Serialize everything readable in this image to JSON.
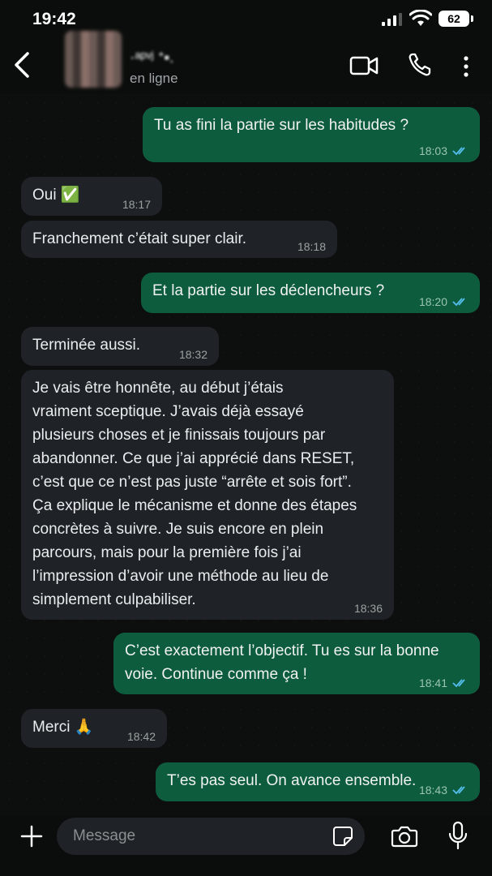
{
  "status_bar": {
    "time": "19:42",
    "battery": "62"
  },
  "header": {
    "contact_name": "·ᵃᵖᵛʲ ᐩ▪.",
    "status": "en ligne"
  },
  "icons": {
    "back": "chevron-left-icon",
    "video": "video-call-icon",
    "call": "phone-icon",
    "more": "more-vertical-icon",
    "plus": "plus-icon",
    "sticker": "sticker-icon",
    "camera": "camera-icon",
    "mic": "microphone-icon",
    "read": "double-check-icon"
  },
  "colors": {
    "incoming": "#1f2226",
    "outgoing": "#0d5c3e",
    "read_ticks": "#53bdeb"
  },
  "messages": [
    {
      "dir": "out",
      "text": "Tu as fini la partie sur les habitudes ?",
      "time": "18:03",
      "read": true
    },
    {
      "dir": "in",
      "text": "Oui ✅",
      "time": "18:17"
    },
    {
      "dir": "in",
      "text": "Franchement c’était super clair.",
      "time": "18:18"
    },
    {
      "dir": "out",
      "text": "Et la partie sur les déclencheurs ?",
      "time": "18:20",
      "read": true
    },
    {
      "dir": "in",
      "text": "Terminée aussi.",
      "time": "18:32"
    },
    {
      "dir": "in",
      "text": "Je vais être honnête, au début j’étais\nvraiment sceptique. J’avais déjà essayé\nplusieurs choses et je finissais toujours par\nabandonner. Ce que j’ai apprécié dans RESET,\nc’est que ce n’est pas juste “arrête et sois fort”.\nÇa explique le mécanisme et donne des étapes\nconcrètes à suivre. Je suis encore en plein\nparcours, mais pour la première fois j’ai\nl’impression d’avoir une méthode au lieu de\nsimplement culpabiliser.",
      "time": "18:36"
    },
    {
      "dir": "out",
      "text": "C’est exactement l’objectif. Tu es sur la bonne\nvoie. Continue comme ça !",
      "time": "18:41",
      "read": true
    },
    {
      "dir": "in",
      "text": "Merci 🙏",
      "time": "18:42"
    },
    {
      "dir": "out",
      "text": "T’es pas seul. On avance ensemble.",
      "time": "18:43",
      "read": true
    }
  ],
  "input": {
    "placeholder": "Message",
    "value": ""
  }
}
